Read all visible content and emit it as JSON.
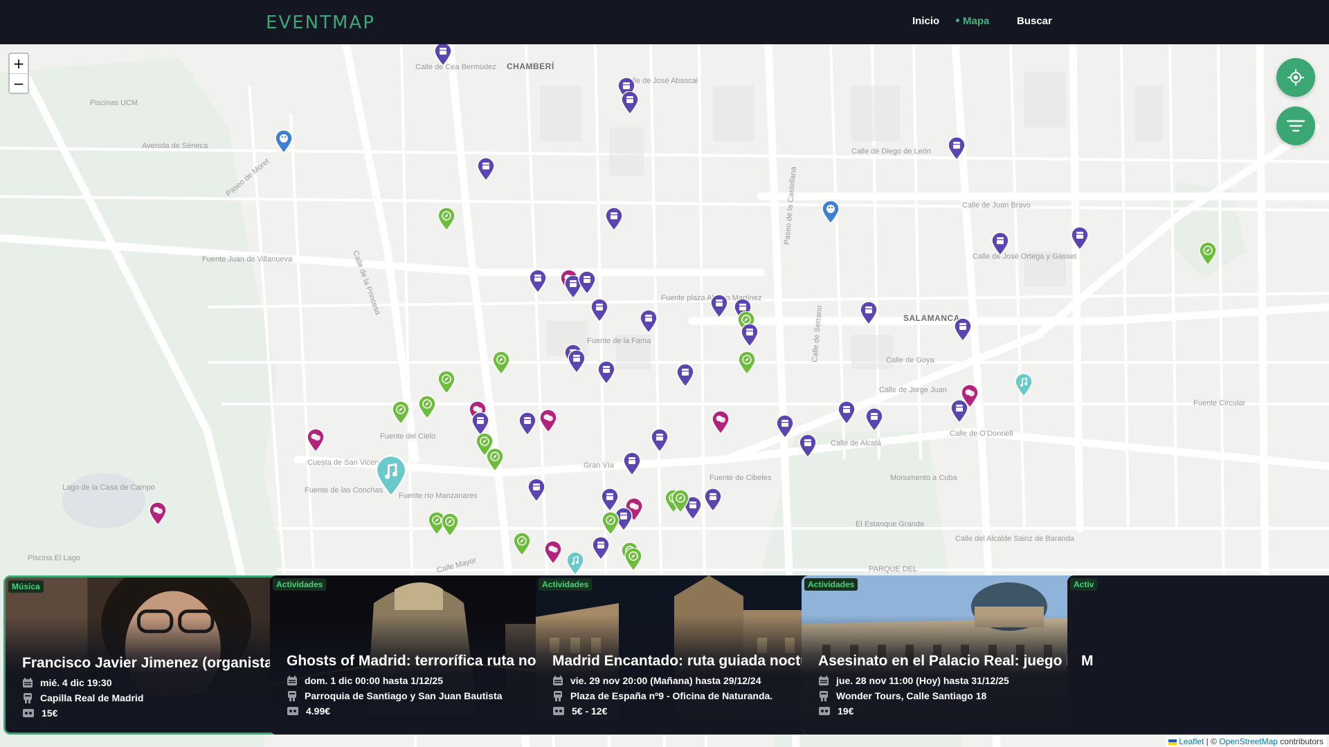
{
  "header": {
    "logo": "EVENTMAP",
    "nav": [
      {
        "label": "Inicio",
        "active": false
      },
      {
        "label": "Mapa",
        "active": true
      },
      {
        "label": "Buscar",
        "active": false
      }
    ]
  },
  "map": {
    "zoom_in": "+",
    "zoom_out": "−",
    "labels": {
      "chamberi": "CHAMBERÍ",
      "salamanca": "SALAMANCA",
      "calle_cea": "Calle de Cea Bermúdez",
      "jose_abascal": "Calle de José Abascal",
      "diego_leon": "Calle de Diego de León",
      "juan_bravo": "Calle de Juan Bravo",
      "ortega_gasset": "Calle de José Ortega y Gasset",
      "avenida_seneca": "Avenida de Séneca",
      "piscinas_ucm": "Piscinas UCM",
      "goya": "Calle de Goya",
      "jorge_juan": "Calle de Jorge Juan",
      "alcala": "Calle de Alcalá",
      "odonnell": "Calle de O'Donnell",
      "gran_via": "Gran Vía",
      "cuesta_san_vicente": "Cuesta de San Vicente",
      "fuente_cielo": "Fuente del Cielo",
      "fuente_cibeles": "Fuente de Cibeles",
      "fuente_circular": "Fuente Circular",
      "monumento_cuba": "Monumento a Cuba",
      "estanque": "El Estanque Grande",
      "lago_casa_campo": "Lago de la Casa de Campo",
      "piscina_lago": "Piscina El Lago",
      "fuente_conchas": "Fuente de las Conchas",
      "fuente_manzanares": "Fuente río Manzanares",
      "alcalde_sainz": "Calle del Alcalde Sainz de Baranda",
      "parque_del": "PARQUE DEL",
      "fuente_fama": "Fuente de la Fama",
      "fuente_plaza": "Fuente plaza Alonso Martínez",
      "fuente_juan": "Fuente Juan de Villanueva",
      "paseo_castellana": "Paseo de la Castellana",
      "calle_serrano": "Calle de Serrano",
      "calle_princesa": "Calle de la Princesa",
      "paseo_moret": "Paseo de Moret",
      "calle_mayor": "Calle Mayor"
    }
  },
  "cards": [
    {
      "category": "Música",
      "title": "Francisco Javier Jimenez (organista) y Ja...",
      "date": "mié. 4 dic 19:30",
      "place": "Capilla Real de Madrid",
      "price": "15€"
    },
    {
      "category": "Actividades",
      "title": "Ghosts of Madrid: terrorífica ruta noctur...",
      "date": "dom. 1 dic 00:00 hasta 1/12/25",
      "place": "Parroquia de Santiago y San Juan Bautista",
      "price": "4.99€"
    },
    {
      "category": "Actividades",
      "title": "Madrid Encantado: ruta guiada nocturna ...",
      "date": "vie. 29 nov 20:00 (Mañana) hasta 29/12/24",
      "place": "Plaza de España nº9 - Oficina de Naturanda.",
      "price": "5€ - 12€"
    },
    {
      "category": "Actividades",
      "title": "Asesinato en el Palacio Real: juego inte...",
      "date": "jue. 28 nov 11:00 (Hoy) hasta 31/12/25",
      "place": "Wonder Tours, Calle Santiago 18",
      "price": "19€"
    },
    {
      "category": "Activ",
      "title": "M",
      "date": "",
      "place": "",
      "price": ""
    }
  ],
  "attribution": {
    "leaflet": "Leaflet",
    "sep": " | © ",
    "osm": "OpenStreetMap",
    "tail": " contributors"
  },
  "colors": {
    "accent": "#3ba773",
    "header_bg": "#141721",
    "marker_purple": "#5b45b0",
    "marker_green": "#6cbd3b",
    "marker_magenta": "#b3237a",
    "marker_teal": "#6cc9c9",
    "marker_blue": "#3f7fd1"
  }
}
